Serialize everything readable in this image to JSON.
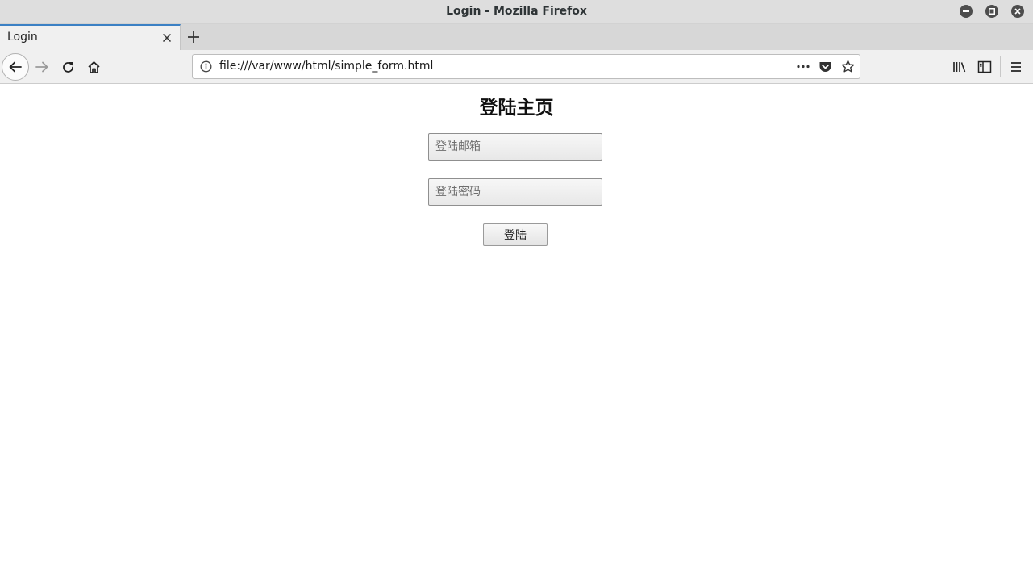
{
  "window": {
    "title": "Login - Mozilla Firefox"
  },
  "tabs": [
    {
      "label": "Login",
      "active": true
    }
  ],
  "navbar": {
    "url": "file:///var/www/html/simple_form.html"
  },
  "icons": {
    "back": "back-arrow-icon",
    "forward": "forward-arrow-icon",
    "reload": "reload-icon",
    "home": "home-icon",
    "info": "info-icon",
    "more": "more-dots-icon",
    "pocket": "pocket-icon",
    "bookmark": "star-icon",
    "library": "library-icon",
    "sidebar": "sidebar-icon",
    "menu": "hamburger-menu-icon"
  },
  "colors": {
    "tab_accent": "#3b80c4",
    "window_control": "#4d4d4d"
  },
  "form": {
    "heading": "登陆主页",
    "email_placeholder": "登陆邮箱",
    "email_value": "",
    "password_placeholder": "登陆密码",
    "password_value": "",
    "submit_label": "登陆"
  }
}
